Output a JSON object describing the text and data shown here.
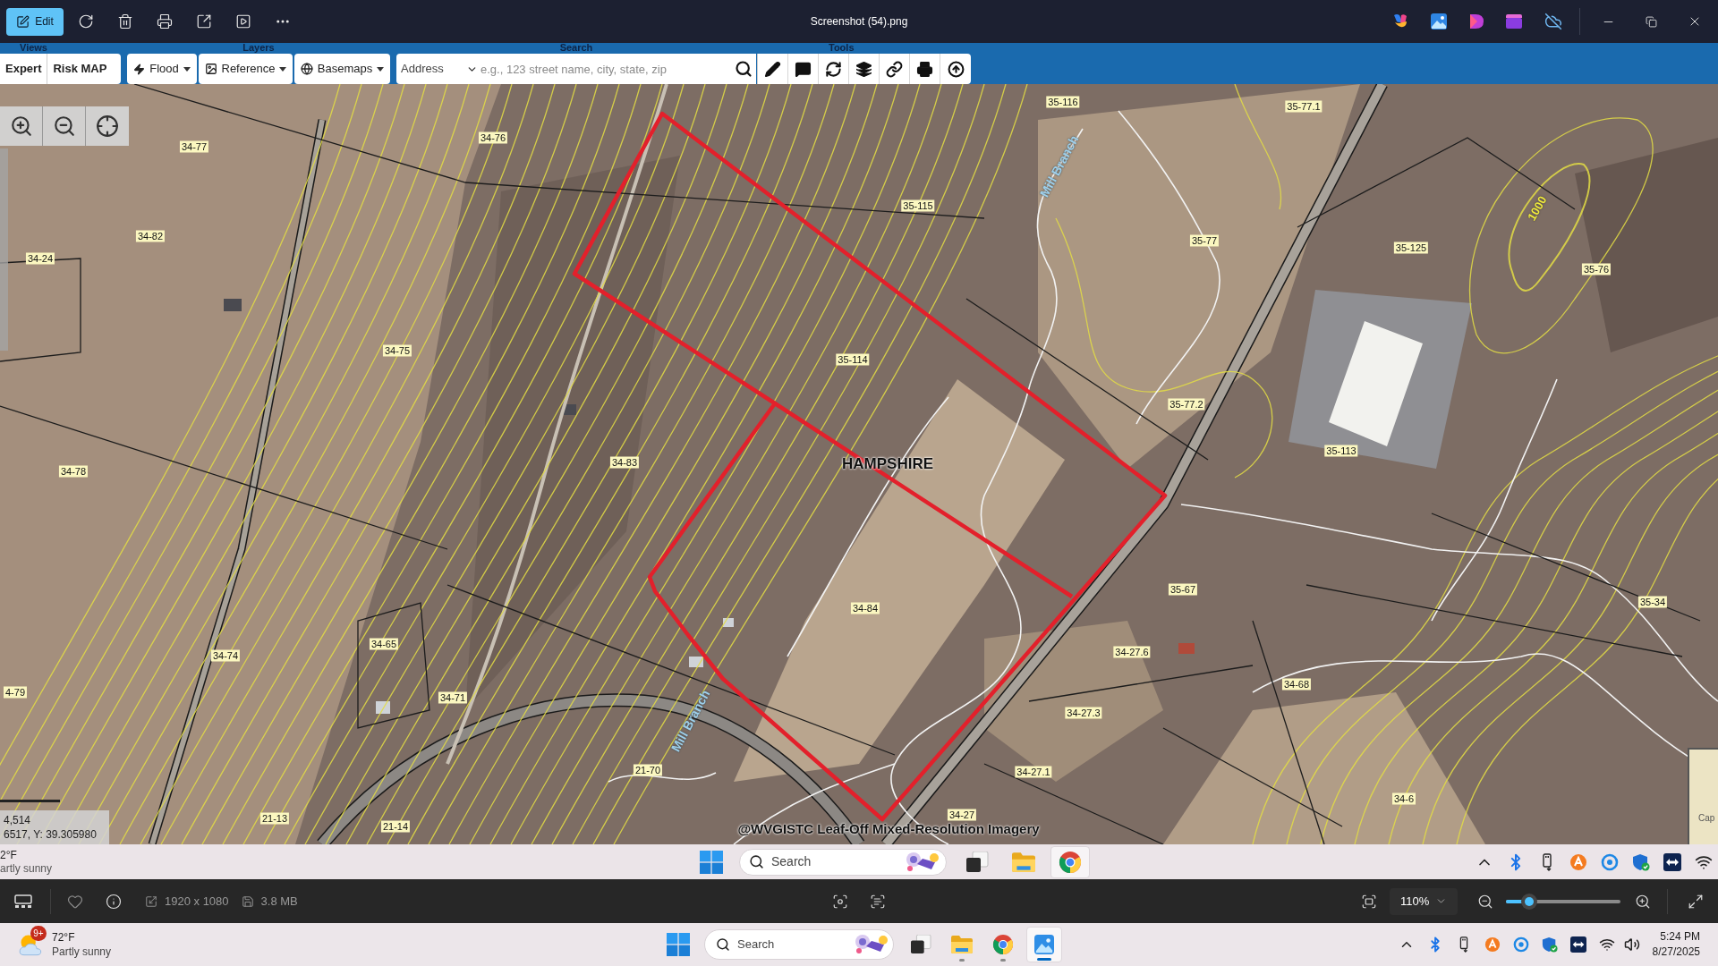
{
  "window": {
    "edit_button": "Edit",
    "title": "Screenshot (54).png"
  },
  "map_page": {
    "toolbar": {
      "sections": [
        "Views",
        "Layers",
        "Search",
        "Tools"
      ],
      "view_buttons": [
        "Expert",
        "Risk MAP"
      ],
      "layer_menus": [
        "Flood",
        "Reference",
        "Basemaps"
      ],
      "search": {
        "type": "Address",
        "placeholder": "e.g., 123 street name, city, state, zip"
      }
    },
    "map": {
      "parcel_labels": [
        "34-77",
        "34-76",
        "34-82",
        "34-24",
        "34-75",
        "34-78",
        "34-83",
        "34-74",
        "34-65",
        "34-71",
        "21-70",
        "21-13",
        "21-14",
        "4-79",
        "35-116",
        "35-115",
        "35-114",
        "35-77.1",
        "35-77",
        "35-125",
        "35-76",
        "35-77.2",
        "35-113",
        "35-67",
        "35-34",
        "34-84",
        "34-27.6",
        "34-68",
        "34-27.3",
        "34-27.1",
        "34-27",
        "34-6"
      ],
      "area_label": "HAMPSHIRE",
      "stream_labels": [
        "Mill Branch",
        "Mill Branch"
      ],
      "contour_label": "1000",
      "attribution": "@WVGISTC Leaf-Off Mixed-Resolution Imagery",
      "scale": "4,514",
      "coordinates": "6517, Y: 39.305980",
      "overview_label": "Cap"
    },
    "taskbar": {
      "weather_temp": "2°F",
      "weather_text": "artly sunny",
      "search": "Search",
      "apps": [
        {
          "kind": "taskview",
          "selected": false
        },
        {
          "kind": "explorer",
          "selected": false
        },
        {
          "kind": "chrome",
          "selected": true
        }
      ]
    }
  },
  "info_bar": {
    "dimensions": "1920 x 1080",
    "file_size": "3.8 MB",
    "zoom": "110%",
    "zoom_slider": {
      "level": 0.15
    }
  },
  "taskbar": {
    "weather": {
      "badge": "9+",
      "temp": "72°F",
      "text": "Partly sunny"
    },
    "search": "Search",
    "apps": [
      {
        "kind": "taskview",
        "selected": false,
        "running": false
      },
      {
        "kind": "explorer",
        "selected": false,
        "running": true
      },
      {
        "kind": "chrome",
        "selected": false,
        "running": true
      },
      {
        "kind": "photos",
        "selected": true,
        "running": true
      }
    ],
    "time": "5:24 PM",
    "date": "8/27/2025"
  }
}
